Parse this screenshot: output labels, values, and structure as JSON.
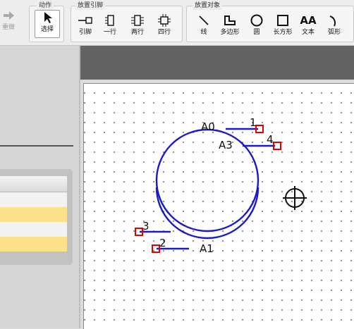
{
  "toolbar": {
    "redo_label": "重做",
    "action_group": {
      "title": "动作",
      "select_label": "选择"
    },
    "pin_group": {
      "title": "放置引脚",
      "pin_label": "引脚",
      "one_row_label": "一行",
      "two_row_label": "两行",
      "four_row_label": "四行"
    },
    "object_group": {
      "title": "放置对象",
      "line_label": "线",
      "polygon_label": "多边形",
      "circle_label": "圆",
      "rect_label": "长方形",
      "text_label": "文本",
      "arc_label": "弧形"
    },
    "text_icon_glyph": "AA"
  },
  "canvas": {
    "pins": [
      {
        "number": "1",
        "name": "A0"
      },
      {
        "number": "4",
        "name": "A3"
      },
      {
        "number": "3",
        "name": ""
      },
      {
        "number": "2",
        "name": "A1"
      }
    ]
  },
  "colors": {
    "shape": "#1a1acc",
    "pin_marker": "#e00000",
    "toolbar_bg": "#ededed",
    "canvas_header": "#636363",
    "list_highlight": "#fde08a"
  }
}
